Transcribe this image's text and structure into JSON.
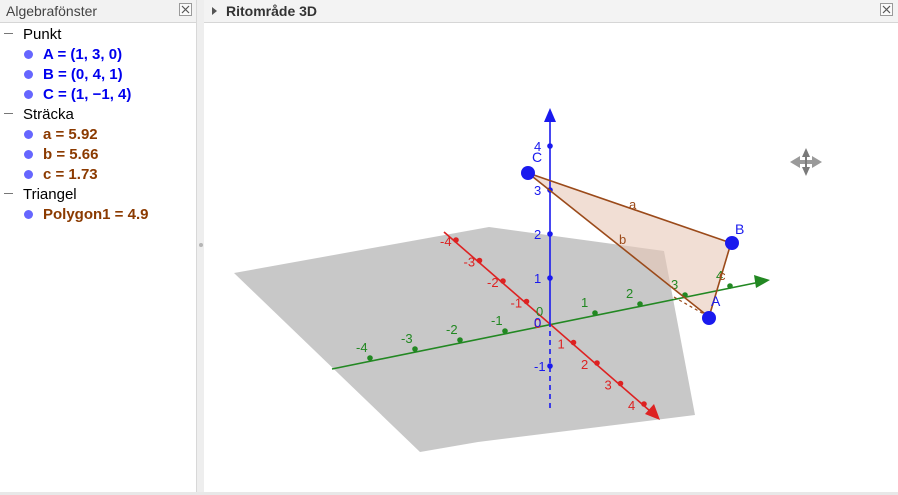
{
  "algebra": {
    "title": "Algebrafönster",
    "groups": [
      {
        "label": "Punkt",
        "items": [
          {
            "text": "A = (1, 3, 0)"
          },
          {
            "text": "B = (0, 4, 1)"
          },
          {
            "text": "C = (1, −1, 4)"
          }
        ]
      },
      {
        "label": "Sträcka",
        "items": [
          {
            "text": "a = 5.92"
          },
          {
            "text": "b = 5.66"
          },
          {
            "text": "c = 1.73"
          }
        ]
      },
      {
        "label": "Triangel",
        "items": [
          {
            "text": "Polygon1 = 4.9"
          }
        ]
      }
    ]
  },
  "view3d": {
    "title": "Ritområde 3D",
    "point_labels": {
      "A": "A",
      "B": "B",
      "C": "C"
    },
    "segment_labels": {
      "a": "a",
      "b": "b",
      "c": "c"
    },
    "x_ticks": [
      "-4",
      "-3",
      "-2",
      "-1",
      "0",
      "1",
      "2",
      "3",
      "4"
    ],
    "y_ticks": [
      "-4",
      "-3",
      "-2",
      "-1",
      "0",
      "1",
      "2",
      "3",
      "4"
    ],
    "z_ticks": [
      "-1",
      "0",
      "1",
      "2",
      "3",
      "4"
    ],
    "colors": {
      "x_axis": "#dd2222",
      "y_axis": "#228822",
      "z_axis": "#1a1aee",
      "point": "#1a1aee",
      "segment": "#9b4a1a",
      "polygon_fill": "#e8c8b8",
      "plane": "#b3b3b3"
    }
  }
}
